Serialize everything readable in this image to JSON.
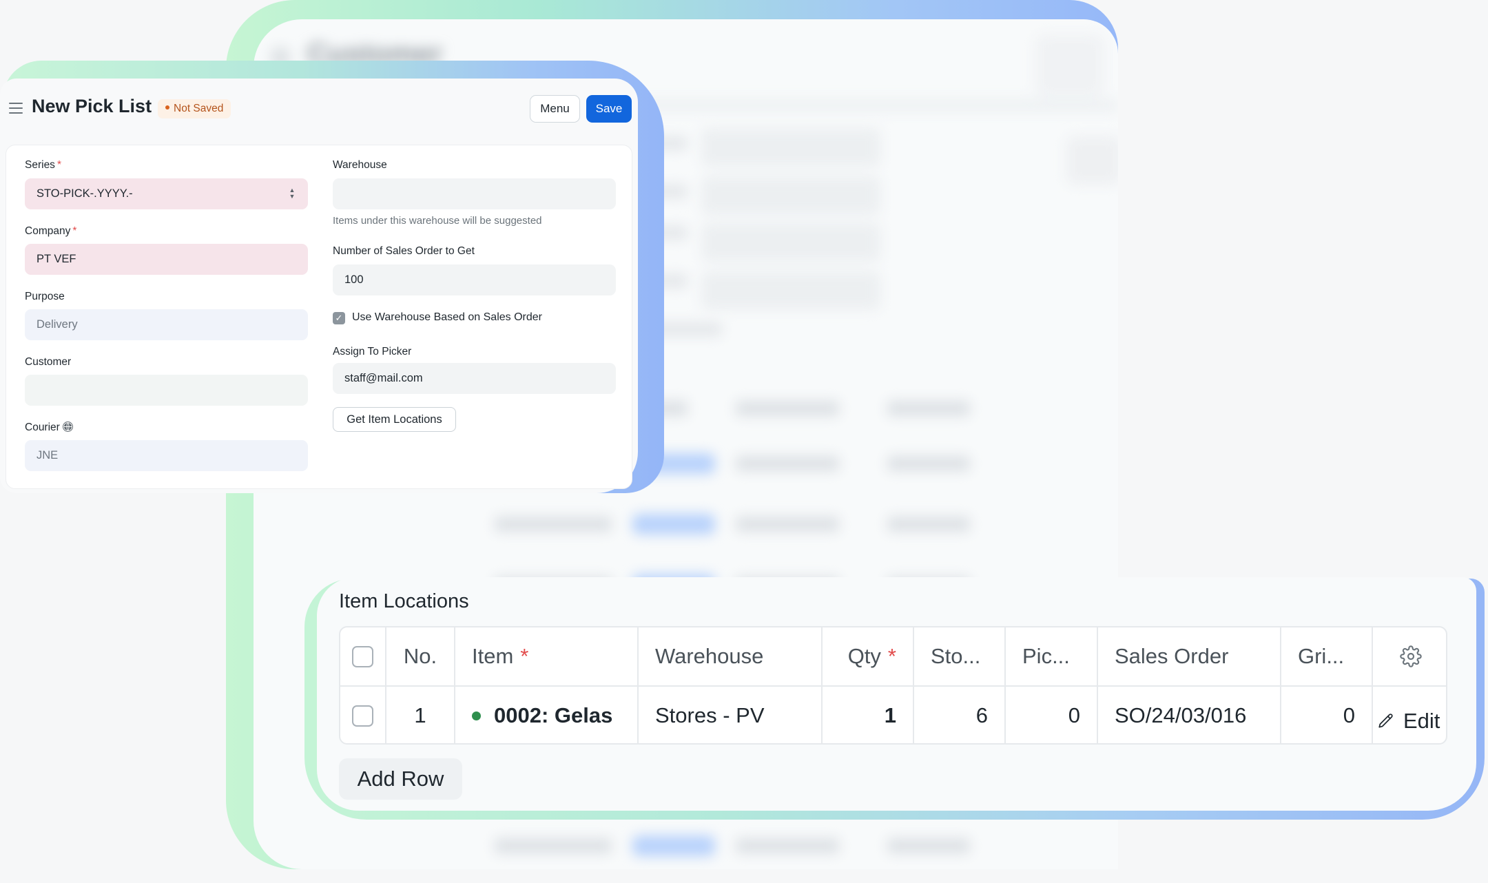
{
  "background_window": {
    "title": "Customer"
  },
  "pick_list": {
    "title": "New Pick List",
    "status_badge": "Not Saved",
    "menu_label": "Menu",
    "save_label": "Save",
    "series": {
      "label": "Series",
      "value": "STO-PICK-.YYYY.-",
      "required": "*"
    },
    "company": {
      "label": "Company",
      "value": "PT VEF",
      "required": "*"
    },
    "purpose": {
      "label": "Purpose",
      "value": "Delivery"
    },
    "customer": {
      "label": "Customer",
      "value": ""
    },
    "courier": {
      "label": "Courier",
      "value": "JNE",
      "icon": "globe-icon"
    },
    "warehouse": {
      "label": "Warehouse",
      "value": "",
      "help": "Items under this warehouse will be suggested"
    },
    "sales_order_count": {
      "label": "Number of Sales Order to Get",
      "value": "100"
    },
    "use_warehouse_checkbox": {
      "label": "Use Warehouse Based on Sales Order",
      "checked": true
    },
    "assign_to_picker": {
      "label": "Assign To Picker",
      "value": "staff@mail.com"
    },
    "get_item_locations_label": "Get Item Locations"
  },
  "item_locations": {
    "title": "Item Locations",
    "columns": {
      "no": "No.",
      "item": "Item",
      "item_required": "*",
      "warehouse": "Warehouse",
      "qty": "Qty",
      "qty_required": "*",
      "stock": "Sto...",
      "picked": "Pic...",
      "sales_order": "Sales Order",
      "grid": "Gri..."
    },
    "rows": [
      {
        "no": "1",
        "item": "0002: Gelas",
        "warehouse": "Stores - PV",
        "qty": "1",
        "stock": "6",
        "picked": "0",
        "sales_order": "SO/24/03/016",
        "grid": "0",
        "edit_label": "Edit"
      }
    ],
    "add_row_label": "Add Row"
  },
  "colors": {
    "primary_button": "#1266dd",
    "not_saved_text": "#b4541c",
    "not_saved_bg": "#fdf1e6",
    "required_marker": "#e24c4c",
    "item_status_dot": "#2f8f4e"
  }
}
